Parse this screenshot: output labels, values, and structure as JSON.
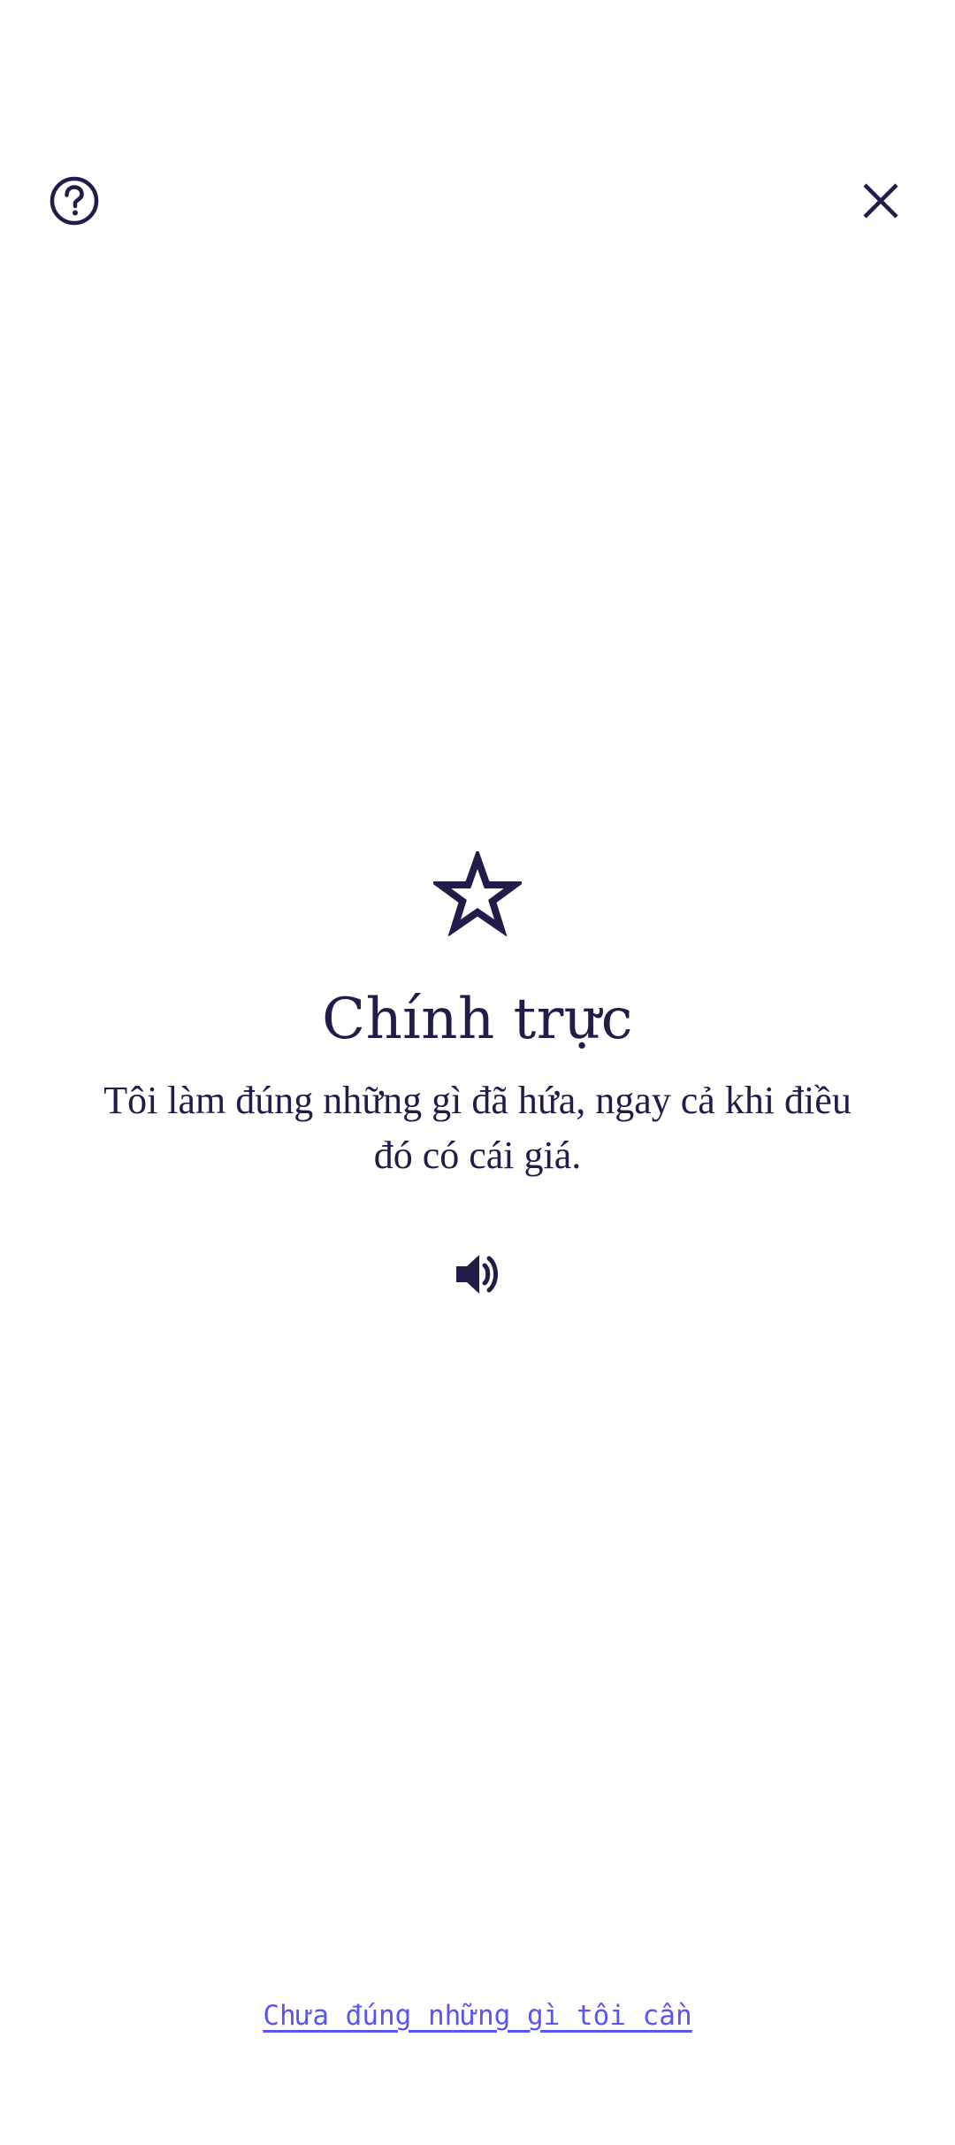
{
  "header": {
    "help_icon": "help-circle-icon",
    "close_icon": "close-icon"
  },
  "value_card": {
    "icon": "star-outline-icon",
    "title": "Chính trực",
    "description": "Tôi làm đúng những gì đã hứa, ngay cả khi điều đó có cái giá.",
    "audio_icon": "speaker-icon"
  },
  "footer": {
    "link_label": "Chưa đúng những gì tôi cần"
  },
  "colors": {
    "primary": "#211d4a",
    "link": "#5a55f0",
    "background": "#ffffff"
  }
}
